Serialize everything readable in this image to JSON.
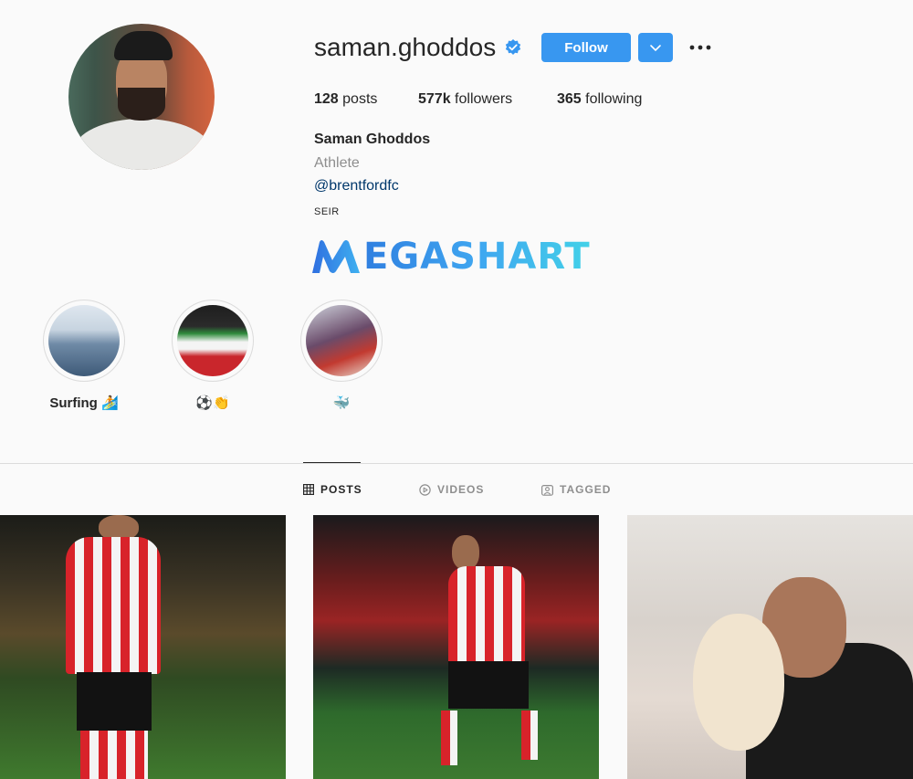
{
  "profile": {
    "username": "saman.ghoddos",
    "verified_icon": "verified-badge-icon",
    "follow_label": "Follow",
    "posts_count": "128",
    "posts_label": " posts",
    "followers_count": "577k",
    "followers_label": " followers",
    "following_count": "365",
    "following_label": " following",
    "full_name": "Saman Ghoddos",
    "category": "Athlete",
    "mention": "@brentfordfc",
    "bio": "SEIR",
    "brand_text": "EGASHART"
  },
  "highlights": [
    {
      "label": "Surfing 🏄"
    },
    {
      "label": "⚽️👏"
    },
    {
      "label": "🐳"
    }
  ],
  "tabs": {
    "posts": "POSTS",
    "videos": "VIDEOS",
    "tagged": "TAGGED"
  },
  "colors": {
    "accent": "#3897f0",
    "link": "#00376b",
    "muted": "#8e8e8e"
  }
}
